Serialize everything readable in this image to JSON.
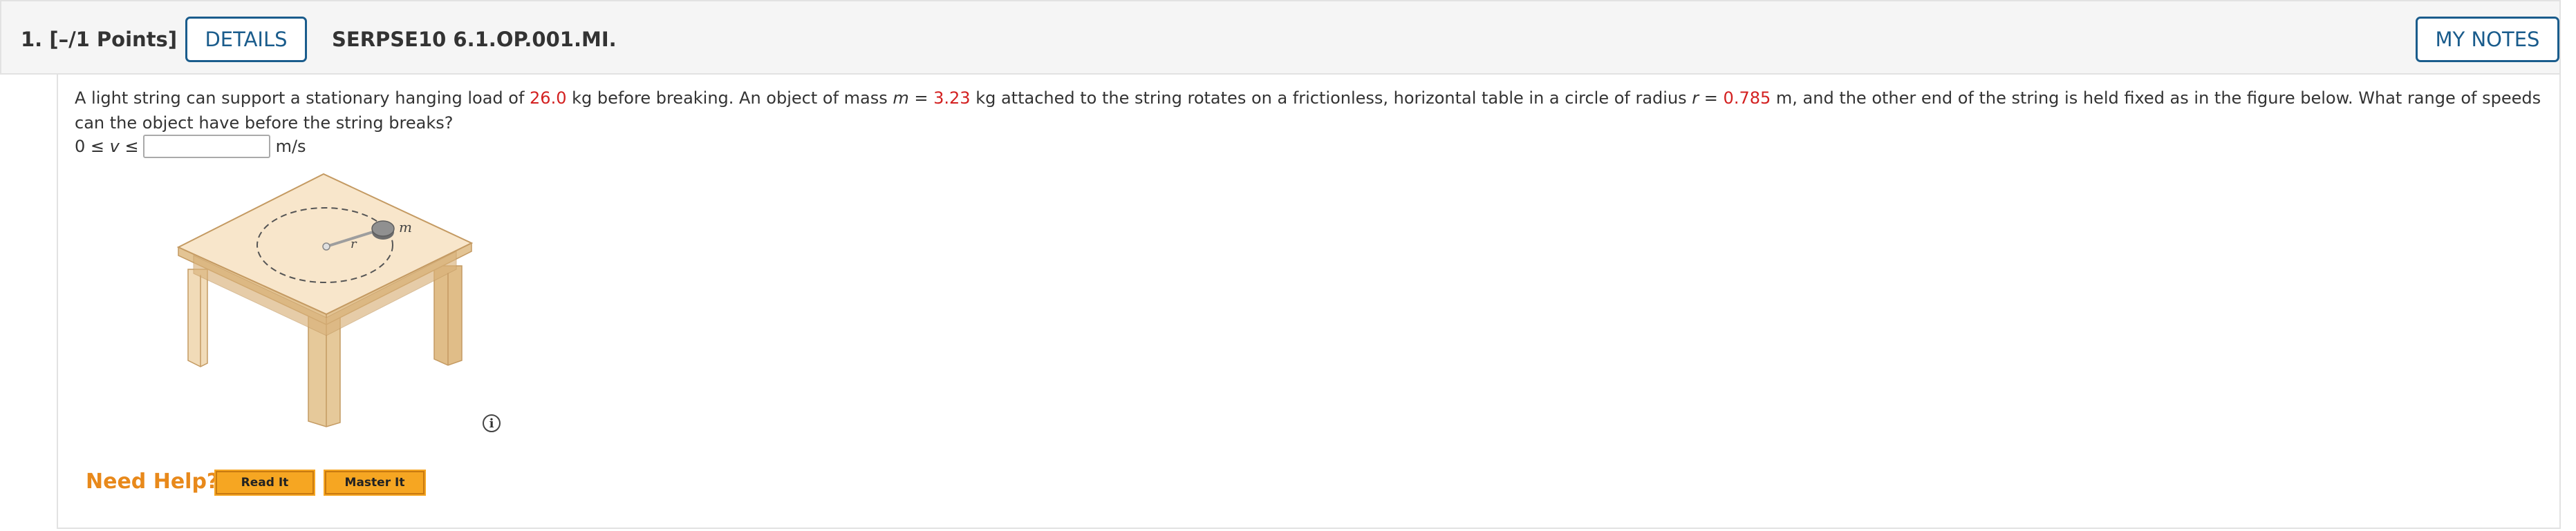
{
  "header": {
    "question_number": "1.",
    "points": "[–/1 Points]",
    "details_label": "DETAILS",
    "code": "SERPSE10 6.1.OP.001.MI.",
    "mynotes_label": "MY NOTES"
  },
  "question": {
    "t1": "A light string can support a stationary hanging load of ",
    "load": "26.0",
    "t2": " kg before breaking. An object of mass ",
    "m_symbol": "m",
    "t3": " = ",
    "mass": "3.23",
    "t4": " kg attached to the string rotates on a frictionless, horizontal table in a circle of radius ",
    "r_symbol": "r",
    "t5": " = ",
    "radius": "0.785",
    "t6": " m, and the other end of the string is held fixed as in the figure below. What range of speeds can the object have before the string breaks?"
  },
  "answer": {
    "prefix_a": "0 ≤ ",
    "v_symbol": "v",
    "prefix_b": " ≤",
    "value": "",
    "unit": "m/s"
  },
  "figure": {
    "mass_label": "m",
    "radius_label": "r"
  },
  "help": {
    "need_help": "Need Help?",
    "read_it": "Read It",
    "master_it": "Master It"
  },
  "info_icon": "i"
}
